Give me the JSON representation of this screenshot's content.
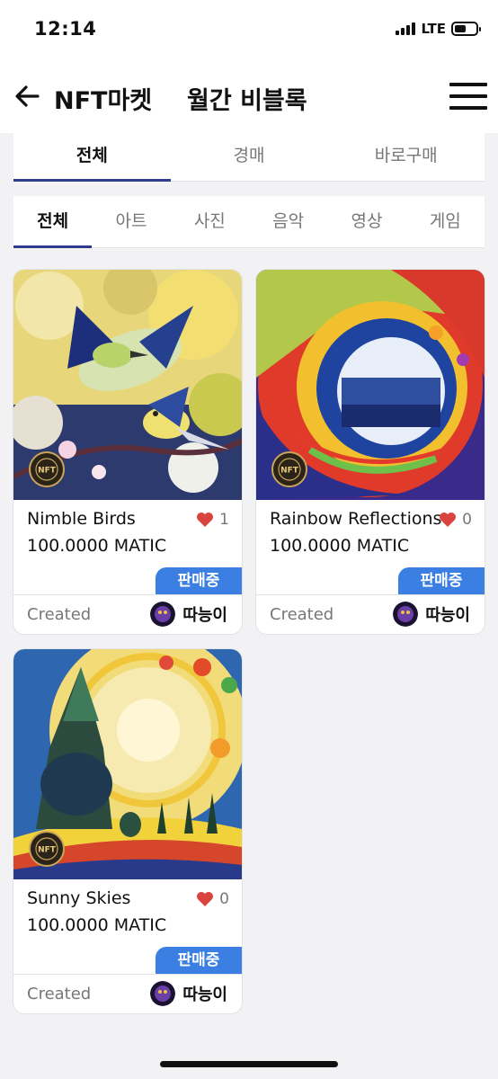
{
  "status_bar": {
    "time": "12:14",
    "network": "LTE",
    "battery_level": 0.55
  },
  "app_bar": {
    "title": "NFT마켓",
    "subtitle": "월간 비블록"
  },
  "sale_tabs": [
    {
      "label": "전체",
      "active": true
    },
    {
      "label": "경매",
      "active": false
    },
    {
      "label": "바로구매",
      "active": false
    }
  ],
  "category_tabs": [
    {
      "label": "전체",
      "active": true
    },
    {
      "label": "아트",
      "active": false
    },
    {
      "label": "사진",
      "active": false
    },
    {
      "label": "음악",
      "active": false
    },
    {
      "label": "영상",
      "active": false
    },
    {
      "label": "게임",
      "active": false
    }
  ],
  "cards": [
    {
      "name": "Nimble Birds",
      "likes": "1",
      "price": "100.0000 MATIC",
      "status": "판매중",
      "created_label": "Created",
      "owner": "따능이",
      "badge_icon": "nft-certified-badge-icon"
    },
    {
      "name": "Rainbow Reflections",
      "likes": "0",
      "price": "100.0000 MATIC",
      "status": "판매중",
      "created_label": "Created",
      "owner": "따능이",
      "badge_icon": "nft-certified-badge-icon"
    },
    {
      "name": "Sunny Skies",
      "likes": "0",
      "price": "100.0000 MATIC",
      "status": "판매중",
      "created_label": "Created",
      "owner": "따능이",
      "badge_icon": "nft-certified-badge-icon"
    }
  ],
  "colors": {
    "accent_blue": "#3b7fe3",
    "tab_underline": "#2d3e8f",
    "heart_red": "#d9443f"
  }
}
